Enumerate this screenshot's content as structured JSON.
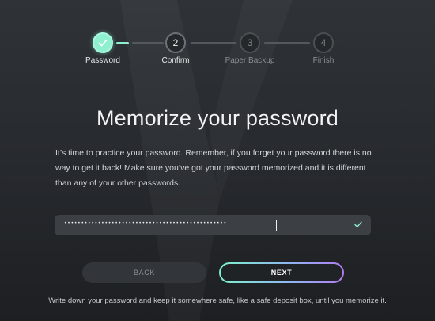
{
  "stepper": {
    "steps": [
      {
        "number": "",
        "label": "Password",
        "state": "done"
      },
      {
        "number": "2",
        "label": "Confirm",
        "state": "current"
      },
      {
        "number": "3",
        "label": "Paper Backup",
        "state": "future"
      },
      {
        "number": "4",
        "label": "Finish",
        "state": "future"
      }
    ],
    "accent_color": "#8ff0d0"
  },
  "main": {
    "title": "Memorize your password",
    "description": "It’s time to practice your password. Remember, if you forget your password there is no way to get it back! Make sure you’ve got your password memorized and it is different than any of your other passwords."
  },
  "password_field": {
    "masked_value": "••••••••••••••••••••••••••••••••••••••••••••••••",
    "status_icon": "check-icon",
    "status": "valid"
  },
  "buttons": {
    "back_label": "BACK",
    "next_label": "NEXT"
  },
  "footer": {
    "note": "Write down your password and keep it somewhere safe, like a safe deposit box, until you memorize it."
  }
}
